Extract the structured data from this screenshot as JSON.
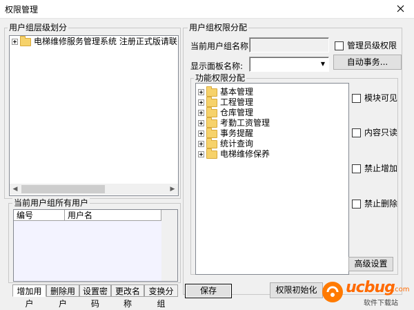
{
  "window": {
    "title": "权限管理",
    "close_glyph": "✕"
  },
  "left": {
    "group_label": "用户组层级划分",
    "tree_root": "电梯维修服务管理系统     注册正式版请联系",
    "users_label": "当前用户组所有用户",
    "columns": [
      "编号",
      "用户名"
    ],
    "tabs": [
      "增加用户",
      "删除用户",
      "设置密码",
      "更改名称",
      "变换分组"
    ]
  },
  "right": {
    "group_label": "用户组权限分配",
    "current_group_label": "当前用户组名称:",
    "current_group_value": "",
    "admin_checkbox": "管理员级权限",
    "panel_label": "显示面板名称:",
    "panel_value": "",
    "auto_button": "自动事务...",
    "func_label": "功能权限分配",
    "func_items": [
      "基本管理",
      "工程管理",
      "仓库管理",
      "考勤工资管理",
      "事务提醒",
      "统计查询",
      "电梯维修保养"
    ],
    "checks": [
      "模块可见",
      "内容只读",
      "禁止增加",
      "禁止删除"
    ],
    "advanced_button": "高级设置"
  },
  "footer": {
    "save_button": "保存",
    "init_button": "权限初始化"
  },
  "watermark": {
    "text": "ucbug",
    "sub": "软件下载站",
    "domain": ".com"
  }
}
